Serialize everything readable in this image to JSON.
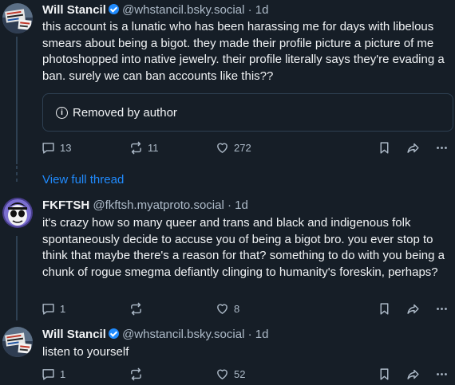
{
  "posts": [
    {
      "display_name": "Will Stancil",
      "handle": "@whstancil.bsky.social",
      "separator": "·",
      "time": "1d",
      "text": "this account is a lunatic who has been harassing me for days with libelous smears about being a bigot. they made their profile picture a picture of me photoshopped into native jewelry. their profile literally says they're evading a ban. surely we can ban accounts like this??",
      "embed_text": "Removed by author",
      "replies": "13",
      "reposts": "11",
      "likes": "272"
    },
    {
      "display_name": "FKFTSH",
      "handle": "@fkftsh.myatproto.social",
      "separator": "·",
      "time": "1d",
      "text": "it's crazy how so many queer and trans and black and indigenous folk spontaneously decide to accuse you of being a bigot bro. you ever stop to think that maybe there's a reason for that? something to do with you being a chunk of rogue smegma defiantly clinging to humanity's foreskin, perhaps?",
      "replies": "1",
      "reposts": "",
      "likes": "8"
    },
    {
      "display_name": "Will Stancil",
      "handle": "@whstancil.bsky.social",
      "separator": "·",
      "time": "1d",
      "text": "listen to yourself",
      "replies": "1",
      "reposts": "",
      "likes": "52"
    }
  ],
  "view_full_thread": "View full thread",
  "icons": [
    "reply-icon",
    "repost-icon",
    "like-icon",
    "bookmark-icon",
    "share-icon",
    "more-icon",
    "verified-badge-icon",
    "info-icon"
  ],
  "colors": {
    "background": "#161e27",
    "text": "#f1f3f5",
    "muted": "#aebbc9",
    "accent": "#208bfe",
    "border": "#2e4052"
  }
}
